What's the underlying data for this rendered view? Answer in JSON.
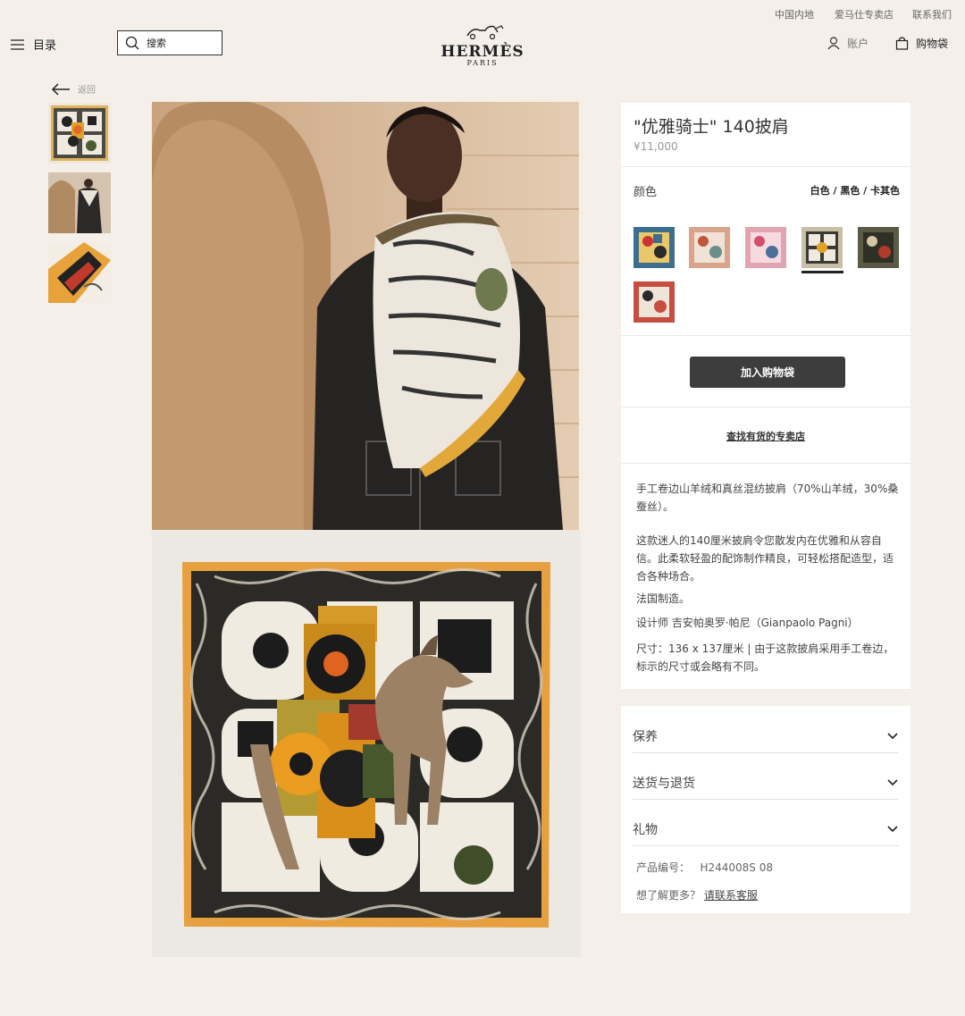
{
  "utility_links": [
    "中国内地",
    "爱马仕专卖店",
    "联系我们"
  ],
  "header": {
    "menu_label": "目录",
    "search_placeholder": "搜索",
    "logo_title": "HERMÈS",
    "logo_sub": "PARIS",
    "account_label": "账户",
    "cart_label": "购物袋"
  },
  "back_label": "返回",
  "product": {
    "title": "\"优雅骑士\" 140披肩",
    "price": "¥11,000",
    "color_label": "颜色",
    "color_value": "白色 / 黑色 / 卡其色",
    "add_to_bag": "加入购物袋",
    "find_store": "查找有货的专卖店",
    "desc_1": "手工卷边山羊绒和真丝混纺披肩（70%山羊绒，30%桑蚕丝）。",
    "desc_2": "这款迷人的140厘米披肩令您散发内在优雅和从容自信。此柔软轻盈的配饰制作精良，可轻松搭配造型，适合各种场合。",
    "desc_3": "法国制造。",
    "desc_4": "设计师 吉安帕奥罗·帕尼（Gianpaolo Pagni）",
    "desc_5": "尺寸：136 x 137厘米 | 由于这款披肩采用手工卷边，标示的尺寸或会略有不同。"
  },
  "accordion": [
    "保养",
    "送货与退货",
    "礼物"
  ],
  "meta": {
    "code_label": "产品编号：",
    "code_value": "H244008S 08",
    "more_label": "想了解更多？",
    "more_link": "请联系客服"
  },
  "colors": {
    "background": "#f4efe9",
    "button": "#3d3d3d",
    "panel": "#ffffff"
  },
  "swatches": [
    {
      "name": "swatch-blue",
      "bg": "#3d6e8f"
    },
    {
      "name": "swatch-peach",
      "bg": "#d9a38c"
    },
    {
      "name": "swatch-pink",
      "bg": "#e2a4b1"
    },
    {
      "name": "swatch-white-black-khaki",
      "bg": "#c9bfa7",
      "selected": true
    },
    {
      "name": "swatch-dark-green",
      "bg": "#5a5a46"
    },
    {
      "name": "swatch-red",
      "bg": "#c64d3f"
    }
  ]
}
